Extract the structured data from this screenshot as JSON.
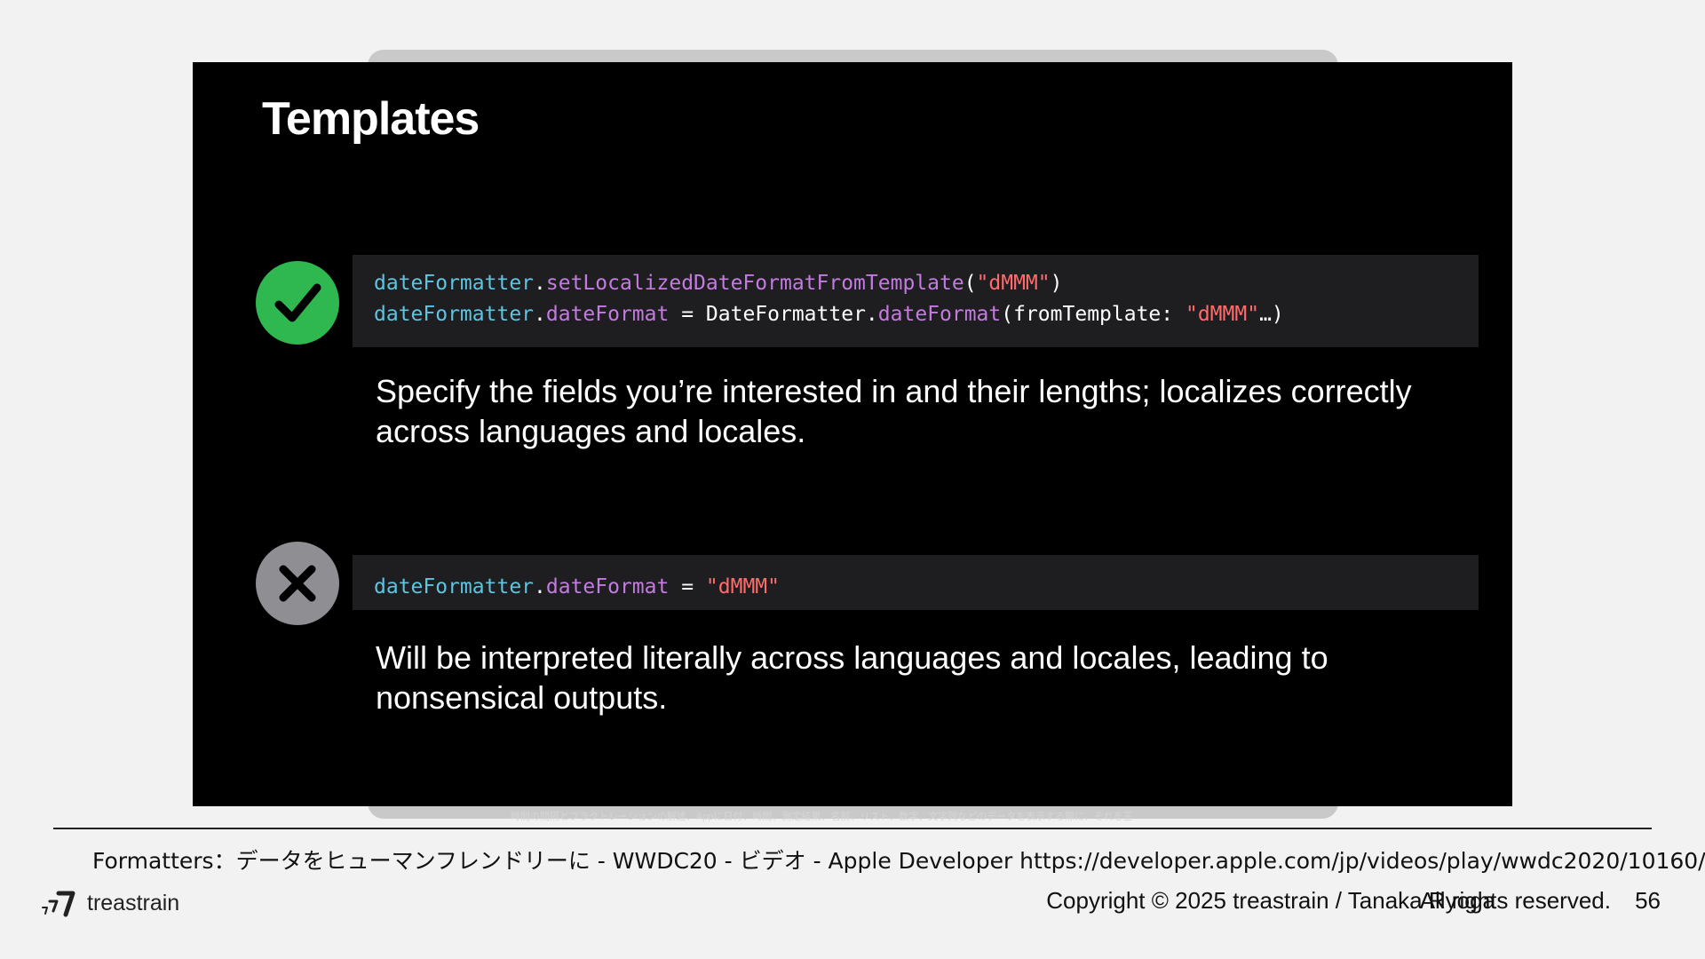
{
  "slide": {
    "title": "Templates",
    "good": {
      "line1": {
        "obj": "dateFormatter",
        "dot": ".",
        "method": "setLocalizedDateFormatFromTemplate",
        "open": "(",
        "str": "\"dMMM\"",
        "close": ")"
      },
      "line2": {
        "obj": "dateFormatter",
        "dot": ".",
        "prop": "dateFormat",
        "eq": " = ",
        "cls": "DateFormatter",
        "dot2": ".",
        "method": "dateFormat",
        "args": "(fromTemplate: ",
        "str": "\"dMMM\"",
        "tail": "…)"
      },
      "description": "Specify the fields you’re interested in and their lengths; localizes correctly across languages and locales."
    },
    "bad": {
      "line1": {
        "obj": "dateFormatter",
        "dot": ".",
        "prop": "dateFormat",
        "eq": " = ",
        "str": "\"dMMM\""
      },
      "description": "Will be interpreted literally across languages and locales, leading to nonsensical outputs."
    },
    "caption": "時間の間隔とフラクトレーションの解述、Appに日付、時間、測定結果、名前、リスト、数字、文字列などのデータを表示する際に、それを王"
  },
  "footer": {
    "source": "Formatters：データをヒューマンフレンドリーに - WWDC20 - ビデオ - Apple Developer https://developer.apple.com/jp/videos/play/wwdc2020/10160/",
    "brand": "treastrain",
    "copyright": "Copyright © 2025 treastrain / Tanaka Ryoga",
    "rights": "All rights reserved.",
    "page": "56"
  },
  "colors": {
    "good_badge": "#2fb84f",
    "bad_badge": "#8e8e93",
    "code_bg": "#1e1e21",
    "code_var": "#5ec4e0",
    "code_method": "#c47be0",
    "code_string": "#ff6b6b"
  }
}
